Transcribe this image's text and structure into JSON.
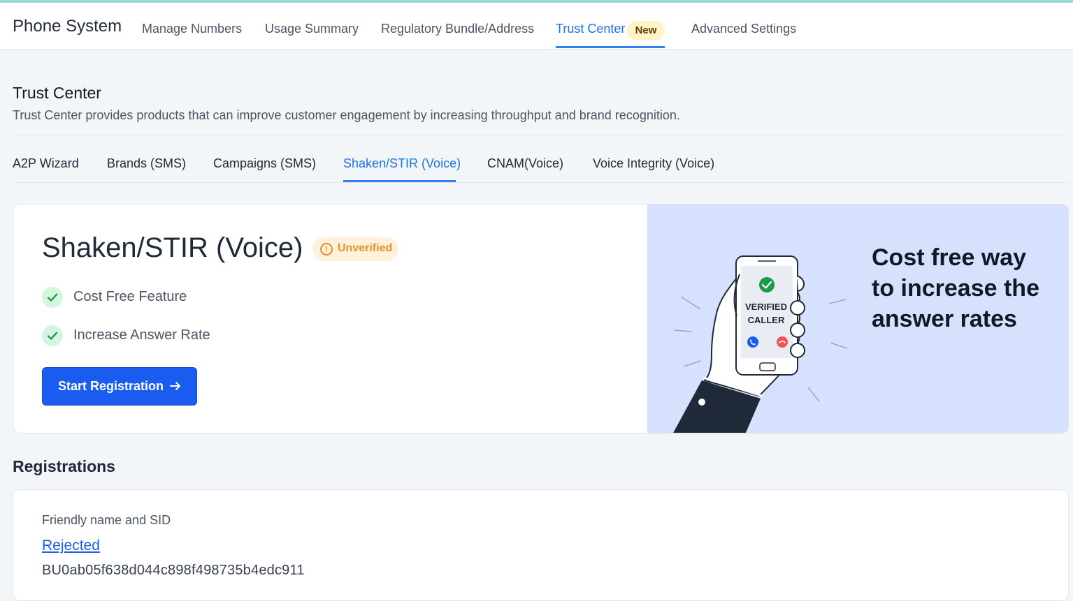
{
  "header": {
    "app_title": "Phone System",
    "nav": [
      {
        "label": "Manage Numbers"
      },
      {
        "label": "Usage Summary"
      },
      {
        "label": "Regulatory Bundle/Address"
      },
      {
        "label": "Trust Center",
        "active": true,
        "badge": "New"
      },
      {
        "label": "Advanced Settings"
      }
    ]
  },
  "section": {
    "title": "Trust Center",
    "description": "Trust Center provides products that can improve customer engagement by increasing throughput and brand recognition."
  },
  "subtabs": [
    {
      "label": "A2P Wizard"
    },
    {
      "label": "Brands (SMS)"
    },
    {
      "label": "Campaigns (SMS)"
    },
    {
      "label": "Shaken/STIR (Voice)",
      "active": true
    },
    {
      "label": "CNAM(Voice)"
    },
    {
      "label": "Voice Integrity (Voice)"
    }
  ],
  "hero": {
    "title": "Shaken/STIR (Voice)",
    "status_badge": "Unverified",
    "features": [
      "Cost Free Feature",
      "Increase Answer Rate"
    ],
    "cta_label": "Start Registration",
    "promo_text": "Cost free way to increase the answer rates",
    "phone_screen": {
      "line1": "VERIFIED",
      "line2": "CALLER"
    }
  },
  "registrations": {
    "title": "Registrations",
    "column_header": "Friendly name and SID",
    "rows": [
      {
        "status": "Rejected",
        "sid": "BU0ab05f638d044c898f498735b4edc911"
      }
    ]
  },
  "colors": {
    "accent": "#1d72e8",
    "primary_button": "#1a5cf0",
    "promo_bg": "#d6e2fd",
    "warning": "#e0941a",
    "success": "#1a9b4b",
    "reject": "#ef5350"
  }
}
